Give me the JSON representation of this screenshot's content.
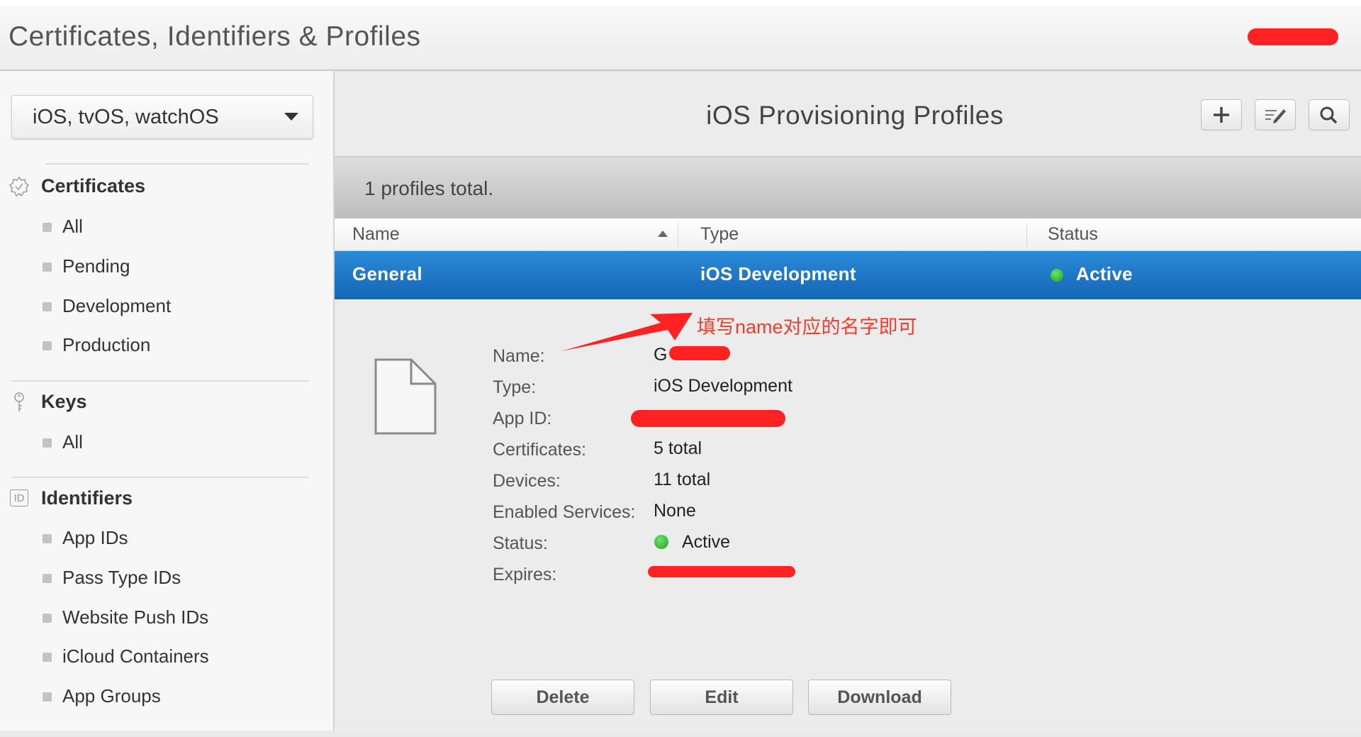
{
  "header": {
    "title": "Certificates, Identifiers & Profiles"
  },
  "sidebar": {
    "platform": "iOS, tvOS, watchOS",
    "sections": {
      "certificates": {
        "label": "Certificates",
        "items": [
          "All",
          "Pending",
          "Development",
          "Production"
        ]
      },
      "keys": {
        "label": "Keys",
        "items": [
          "All"
        ]
      },
      "identifiers": {
        "label": "Identifiers",
        "icon_text": "ID",
        "items": [
          "App IDs",
          "Pass Type IDs",
          "Website Push IDs",
          "iCloud Containers",
          "App Groups"
        ]
      }
    }
  },
  "main": {
    "title": "iOS Provisioning Profiles",
    "toolbar": {
      "add_icon": "plus-icon",
      "edit_icon": "edit-icon",
      "search_icon": "search-icon"
    },
    "count_text": "1 profiles total.",
    "columns": {
      "name": "Name",
      "type": "Type",
      "status": "Status"
    },
    "selected_row": {
      "name": "General",
      "type": "iOS Development",
      "status": "Active"
    },
    "annotation": "填写name对应的名字即可",
    "details": {
      "labels": {
        "name": "Name:",
        "type": "Type:",
        "app_id": "App ID:",
        "certificates": "Certificates:",
        "devices": "Devices:",
        "services": "Enabled Services:",
        "status": "Status:",
        "expires": "Expires:"
      },
      "values": {
        "name": "G",
        "type": "iOS Development",
        "certificates": "5 total",
        "devices": "11 total",
        "services": "None",
        "status": "Active"
      }
    },
    "buttons": {
      "delete": "Delete",
      "edit": "Edit",
      "download": "Download"
    }
  },
  "colors": {
    "selection": "#1a6fc0",
    "annotation": "#f23b2b",
    "status_green": "#22b122"
  }
}
